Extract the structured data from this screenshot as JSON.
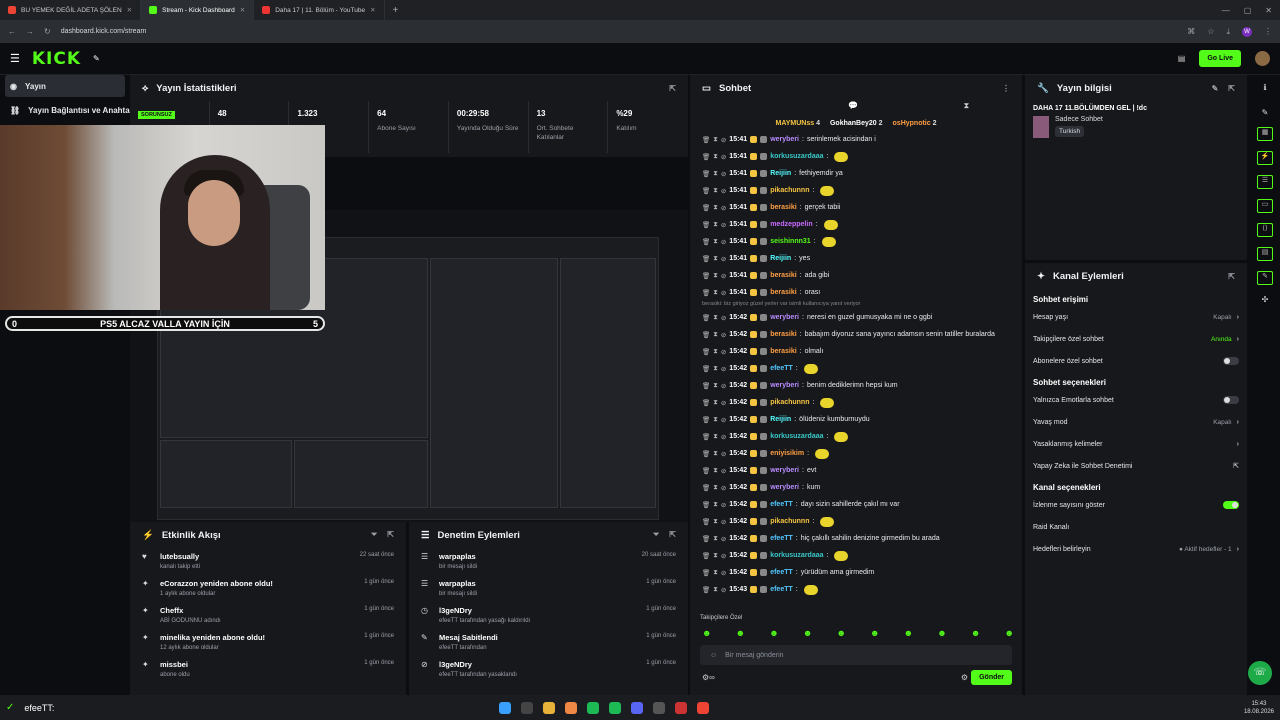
{
  "browser": {
    "tabs": [
      {
        "label": "BU YEMEK DEĞİL ADETA ŞÖLEN",
        "color": "#e43"
      },
      {
        "label": "Stream - Kick Dashboard",
        "color": "#53fc18"
      },
      {
        "label": "Daha 17 | 11. Bölüm - YouTube",
        "color": "#e33"
      }
    ],
    "url": "dashboard.kick.com/stream"
  },
  "topnav": {
    "logo": "KICK",
    "go_live": "Go Live"
  },
  "sidebar": {
    "items": [
      {
        "label": "Yayın"
      },
      {
        "label": "Yayın Bağlantısı ve Anahtar"
      }
    ]
  },
  "stats": {
    "title": "Yayın İstatistikleri",
    "status": "SORUNSUZ",
    "items": [
      {
        "value": "48",
        "label": ""
      },
      {
        "value": "1.323",
        "label": ""
      },
      {
        "value": "64",
        "label": "Abone Sayısı"
      },
      {
        "value": "00:29:58",
        "label": "Yayında Olduğu Süre"
      },
      {
        "value": "13",
        "label": "Ort. Sohbete Katılanlar"
      },
      {
        "value": "%29",
        "label": "Katılım"
      }
    ]
  },
  "overlay": {
    "left": "0",
    "text": "PS5 ALCAZ VALLA YAYIN İÇİN",
    "right": "5"
  },
  "activity": {
    "title": "Etkinlik Akışı",
    "items": [
      {
        "icon": "♥",
        "title": "lutebsually",
        "sub": "kanalı takip etti",
        "time": "22 saat önce"
      },
      {
        "icon": "✦",
        "title": "eCorazzon yeniden abone oldu!",
        "sub": "1 aylık abone oldular",
        "time": "1 gün önce"
      },
      {
        "icon": "✦",
        "title": "Cheffx",
        "sub": "ABİ GODUNNU adındı",
        "time": "1 gün önce"
      },
      {
        "icon": "✦",
        "title": "minelika yeniden abone oldu!",
        "sub": "12 aylık abone oldular",
        "time": "1 gün önce"
      },
      {
        "icon": "✦",
        "title": "missbei",
        "sub": "abone oldu",
        "time": "1 gün önce"
      }
    ]
  },
  "moderation": {
    "title": "Denetim Eylemleri",
    "items": [
      {
        "icon": "☰",
        "title": "warpaplas",
        "sub": "bir mesajı sildi",
        "time": "20 saat önce"
      },
      {
        "icon": "☰",
        "title": "warpaplas",
        "sub": "bir mesajı sildi",
        "time": "1 gün önce"
      },
      {
        "icon": "◷",
        "title": "l3geNDry",
        "sub": "efeeTT tarafından yasağı kaldırıldı",
        "time": "1 gün önce"
      },
      {
        "icon": "✎",
        "title": "Mesaj Sabitlendi",
        "sub": "efeeTT tarafından",
        "time": "1 gün önce"
      },
      {
        "icon": "⊘",
        "title": "l3geNDry",
        "sub": "efeeTT tarafından yasaklandı",
        "time": "1 gün önce"
      }
    ]
  },
  "chat": {
    "title": "Sohbet",
    "pinned": [
      {
        "name": "MAYMUNss",
        "n": "4"
      },
      {
        "name": "GokhanBey20",
        "n": "2"
      },
      {
        "name": "osHypnotic",
        "n": "2"
      }
    ],
    "separator": "berasiki: biz giriyoz güzel yerler var isimli kullanıcıya yanıt veriyor",
    "messages": [
      {
        "time": "15:41",
        "user": "weryberi",
        "color": "#b98cff",
        "text": "serinlemek acisindan i"
      },
      {
        "time": "15:41",
        "user": "korkusuzardaaa",
        "color": "#3ac8c8",
        "text": ""
      },
      {
        "time": "15:41",
        "user": "Reijiin",
        "color": "#53fcff",
        "text": "fethiyemdir ya"
      },
      {
        "time": "15:41",
        "user": "pikachunnn",
        "color": "#f5c542",
        "text": ""
      },
      {
        "time": "15:41",
        "user": "berasiki",
        "color": "#ff9f43",
        "text": "gerçek tabii"
      },
      {
        "time": "15:41",
        "user": "medzeppelin",
        "color": "#c86bff",
        "text": ""
      },
      {
        "time": "15:41",
        "user": "seishinnn31",
        "color": "#53fc18",
        "text": ""
      },
      {
        "time": "15:41",
        "user": "Reijiin",
        "color": "#53fcff",
        "text": "yes"
      },
      {
        "time": "15:41",
        "user": "berasiki",
        "color": "#ff9f43",
        "text": "ada gibi"
      },
      {
        "time": "15:41",
        "user": "berasiki",
        "color": "#ff9f43",
        "text": "orası"
      },
      {
        "time": "15:42",
        "user": "weryberi",
        "color": "#b98cff",
        "text": "neresi en guzel gumusyaka mi ne o ggbi"
      },
      {
        "time": "15:42",
        "user": "berasiki",
        "color": "#ff9f43",
        "text": "babajım diyoruz sana yayıncı adamsın senin tatiller buralarda"
      },
      {
        "time": "15:42",
        "user": "berasiki",
        "color": "#ff9f43",
        "text": "olmalı"
      },
      {
        "time": "15:42",
        "user": "efeeTT",
        "color": "#53c8ff",
        "text": ""
      },
      {
        "time": "15:42",
        "user": "weryberi",
        "color": "#b98cff",
        "text": "benim dediklerimn hepsi kum"
      },
      {
        "time": "15:42",
        "user": "pikachunnn",
        "color": "#f5c542",
        "text": ""
      },
      {
        "time": "15:42",
        "user": "Reijiin",
        "color": "#53fcff",
        "text": "ölüdeniz kumburnuydu"
      },
      {
        "time": "15:42",
        "user": "korkusuzardaaa",
        "color": "#3ac8c8",
        "text": ""
      },
      {
        "time": "15:42",
        "user": "eniyisikim",
        "color": "#ff9f43",
        "text": ""
      },
      {
        "time": "15:42",
        "user": "weryberi",
        "color": "#b98cff",
        "text": "evt"
      },
      {
        "time": "15:42",
        "user": "weryberi",
        "color": "#b98cff",
        "text": "kum"
      },
      {
        "time": "15:42",
        "user": "efeeTT",
        "color": "#53c8ff",
        "text": "dayı sizin sahillerde çakıl mı var"
      },
      {
        "time": "15:42",
        "user": "pikachunnn",
        "color": "#f5c542",
        "text": ""
      },
      {
        "time": "15:42",
        "user": "efeeTT",
        "color": "#53c8ff",
        "text": "hiç çakıllı sahilin denizine girmedim bu arada"
      },
      {
        "time": "15:42",
        "user": "korkusuzardaaa",
        "color": "#3ac8c8",
        "text": ""
      },
      {
        "time": "15:42",
        "user": "efeeTT",
        "color": "#53c8ff",
        "text": "yürüdüm ama girmedim"
      },
      {
        "time": "15:43",
        "user": "efeeTT",
        "color": "#53c8ff",
        "text": ""
      }
    ],
    "followers_only": "Takipçilere Özel",
    "input_placeholder": "Bir mesaj gönderin",
    "send": "Gönder"
  },
  "stream_info": {
    "title": "Yayın bilgisi",
    "stream_title": "DAHA 17 11.BÖLÜMDEN GEL | !dc",
    "chat_mode": "Sadece Sohbet",
    "language": "Turkish"
  },
  "channel_actions": {
    "title": "Kanal Eylemleri",
    "chat_access": "Sohbet erişimi",
    "access_rows": [
      {
        "label": "Hesap yaşı",
        "value": "Kapalı"
      },
      {
        "label": "Takipçilere özel sohbet",
        "value": "Anında"
      },
      {
        "label": "Abonelere özel sohbet",
        "value": ""
      }
    ],
    "chat_options": "Sohbet seçenekleri",
    "option_rows": [
      {
        "label": "Yalnızca Emotlarla sohbet",
        "value": ""
      },
      {
        "label": "Yavaş mod",
        "value": "Kapalı"
      },
      {
        "label": "Yasaklanmış kelimeler",
        "value": ""
      },
      {
        "label": "Yapay Zeka ile Sohbet Denetimi",
        "value": ""
      }
    ],
    "channel_options": "Kanal seçenekleri",
    "channel_rows": [
      {
        "label": "İzlenme sayısını göster",
        "value": ""
      },
      {
        "label": "Raid Kanalı",
        "value": ""
      },
      {
        "label": "Hedefleri belirleyin",
        "value": "● Aktif hedefler - 1"
      }
    ]
  },
  "taskbar": {
    "user": "efeeTT:",
    "time": "15:43",
    "date": "18.08.2026"
  }
}
